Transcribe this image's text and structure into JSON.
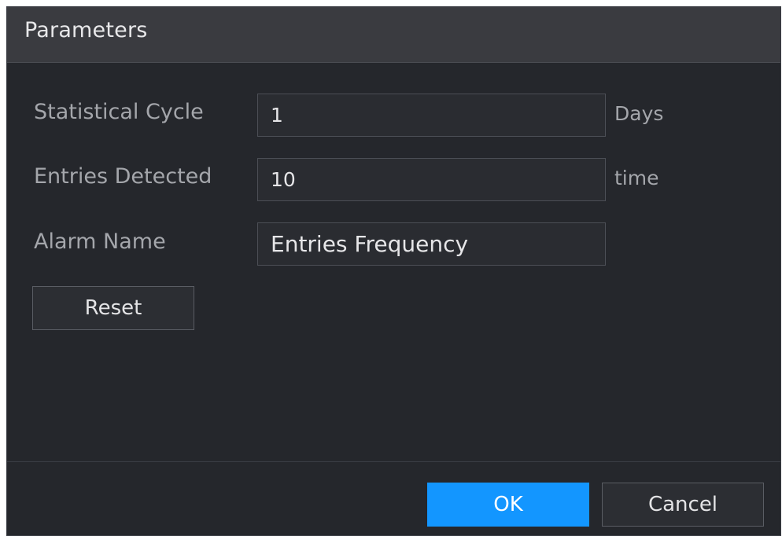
{
  "dialog": {
    "title": "Parameters"
  },
  "fields": {
    "statistical_cycle": {
      "label": "Statistical Cycle",
      "value": "1",
      "unit": "Days"
    },
    "entries_detected": {
      "label": "Entries Detected",
      "value": "10",
      "unit": "time"
    },
    "alarm_name": {
      "label": "Alarm Name",
      "value": "Entries Frequency"
    }
  },
  "buttons": {
    "reset": "Reset",
    "ok": "OK",
    "cancel": "Cancel"
  },
  "colors": {
    "accent": "#1396ff",
    "background": "#25272c",
    "title_bar": "#3a3b40"
  }
}
